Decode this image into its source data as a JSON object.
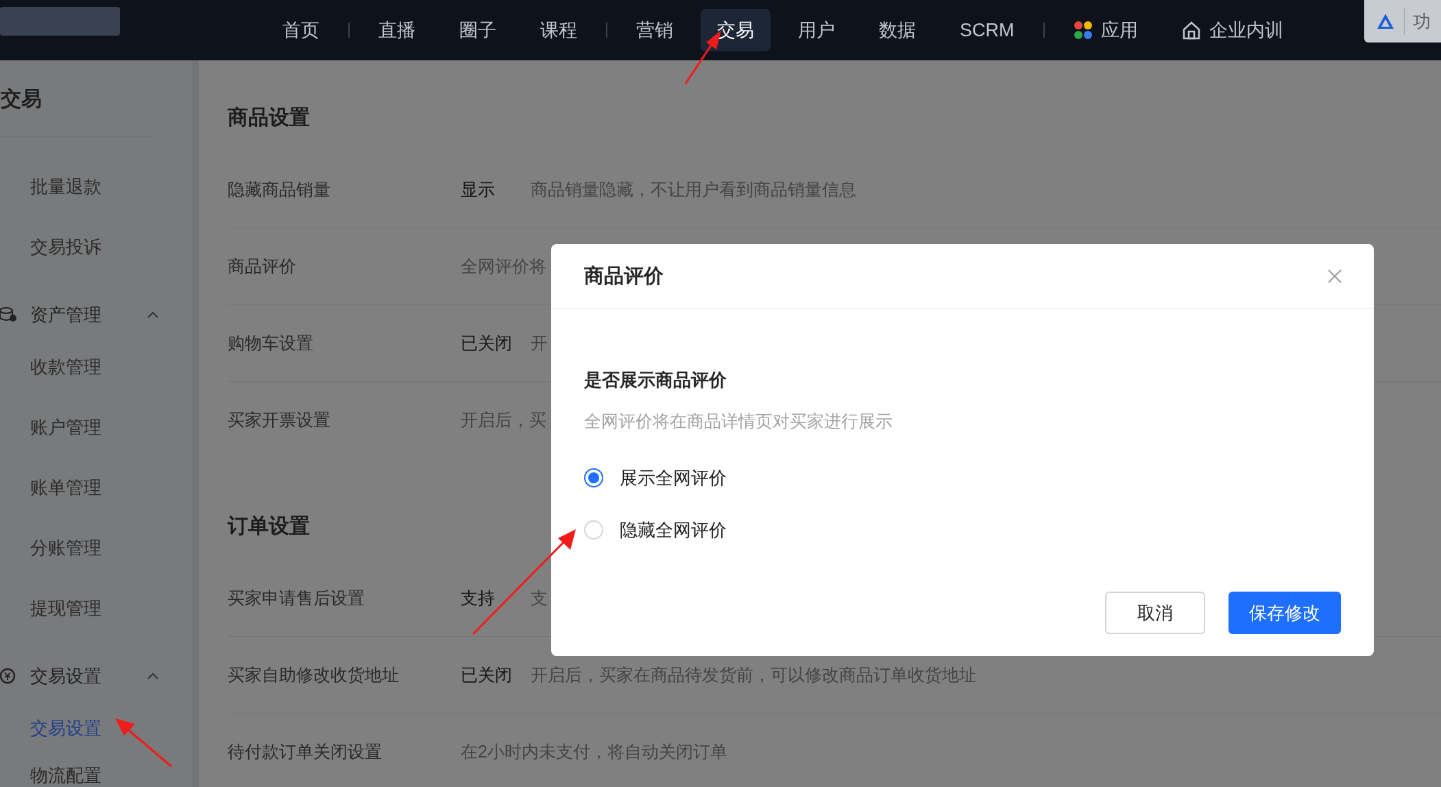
{
  "nav": {
    "items": [
      {
        "label": "首页",
        "kind": "text",
        "selected": false,
        "divider_after": true
      },
      {
        "label": "直播",
        "kind": "text",
        "selected": false,
        "divider_after": false
      },
      {
        "label": "圈子",
        "kind": "text",
        "selected": false,
        "divider_after": false
      },
      {
        "label": "课程",
        "kind": "text",
        "selected": false,
        "divider_after": true
      },
      {
        "label": "营销",
        "kind": "text",
        "selected": false,
        "divider_after": false
      },
      {
        "label": "交易",
        "kind": "text",
        "selected": true,
        "divider_after": false
      },
      {
        "label": "用户",
        "kind": "text",
        "selected": false,
        "divider_after": false
      },
      {
        "label": "数据",
        "kind": "text",
        "selected": false,
        "divider_after": false
      },
      {
        "label": "SCRM",
        "kind": "text",
        "selected": false,
        "divider_after": true
      },
      {
        "label": "应用",
        "kind": "apps",
        "selected": false,
        "divider_after": false
      },
      {
        "label": "企业内训",
        "kind": "training",
        "selected": false,
        "divider_after": false
      }
    ],
    "corner_button": {
      "label": "功"
    }
  },
  "sidebar": {
    "title": "交易",
    "items": [
      {
        "kind": "item",
        "label": "批量退款",
        "selected": false
      },
      {
        "kind": "item",
        "label": "交易投诉",
        "selected": false
      },
      {
        "kind": "group",
        "label": "资产管理",
        "expanded": true,
        "children": [
          {
            "label": "收款管理",
            "selected": false
          },
          {
            "label": "账户管理",
            "selected": false
          },
          {
            "label": "账单管理",
            "selected": false
          },
          {
            "label": "分账管理",
            "selected": false
          },
          {
            "label": "提现管理",
            "selected": false
          }
        ]
      },
      {
        "kind": "group",
        "label": "交易设置",
        "expanded": true,
        "children": [
          {
            "label": "交易设置",
            "selected": true
          },
          {
            "label": "物流配置",
            "selected": false
          }
        ]
      }
    ]
  },
  "sections": [
    {
      "title": "商品设置",
      "rows": [
        {
          "label": "隐藏商品销量",
          "value": "显示",
          "description": "商品销量隐藏，不让用户看到商品销量信息"
        },
        {
          "label": "商品评价",
          "description": "全网评价将"
        },
        {
          "label": "购物车设置",
          "value": "已关闭",
          "description": "开"
        },
        {
          "label": "买家开票设置",
          "description": "开启后，买"
        }
      ]
    },
    {
      "title": "订单设置",
      "rows": [
        {
          "label": "买家申请售后设置",
          "value": "支持",
          "description": "支"
        },
        {
          "label": "买家自助修改收货地址",
          "value": "已关闭",
          "description": "开启后，买家在商品待发货前，可以修改商品订单收货地址"
        },
        {
          "label": "待付款订单关闭设置",
          "description": "在2小时内未支付，将自动关闭订单"
        }
      ]
    }
  ],
  "dialog": {
    "title": "商品评价",
    "question": "是否展示商品评价",
    "hint": "全网评价将在商品详情页对买家进行展示",
    "options": [
      {
        "label": "展示全网评价",
        "selected": true
      },
      {
        "label": "隐藏全网评价",
        "selected": false
      }
    ],
    "buttons": [
      {
        "label": "取消",
        "kind": "secondary"
      },
      {
        "label": "保存修改",
        "kind": "primary"
      }
    ]
  }
}
